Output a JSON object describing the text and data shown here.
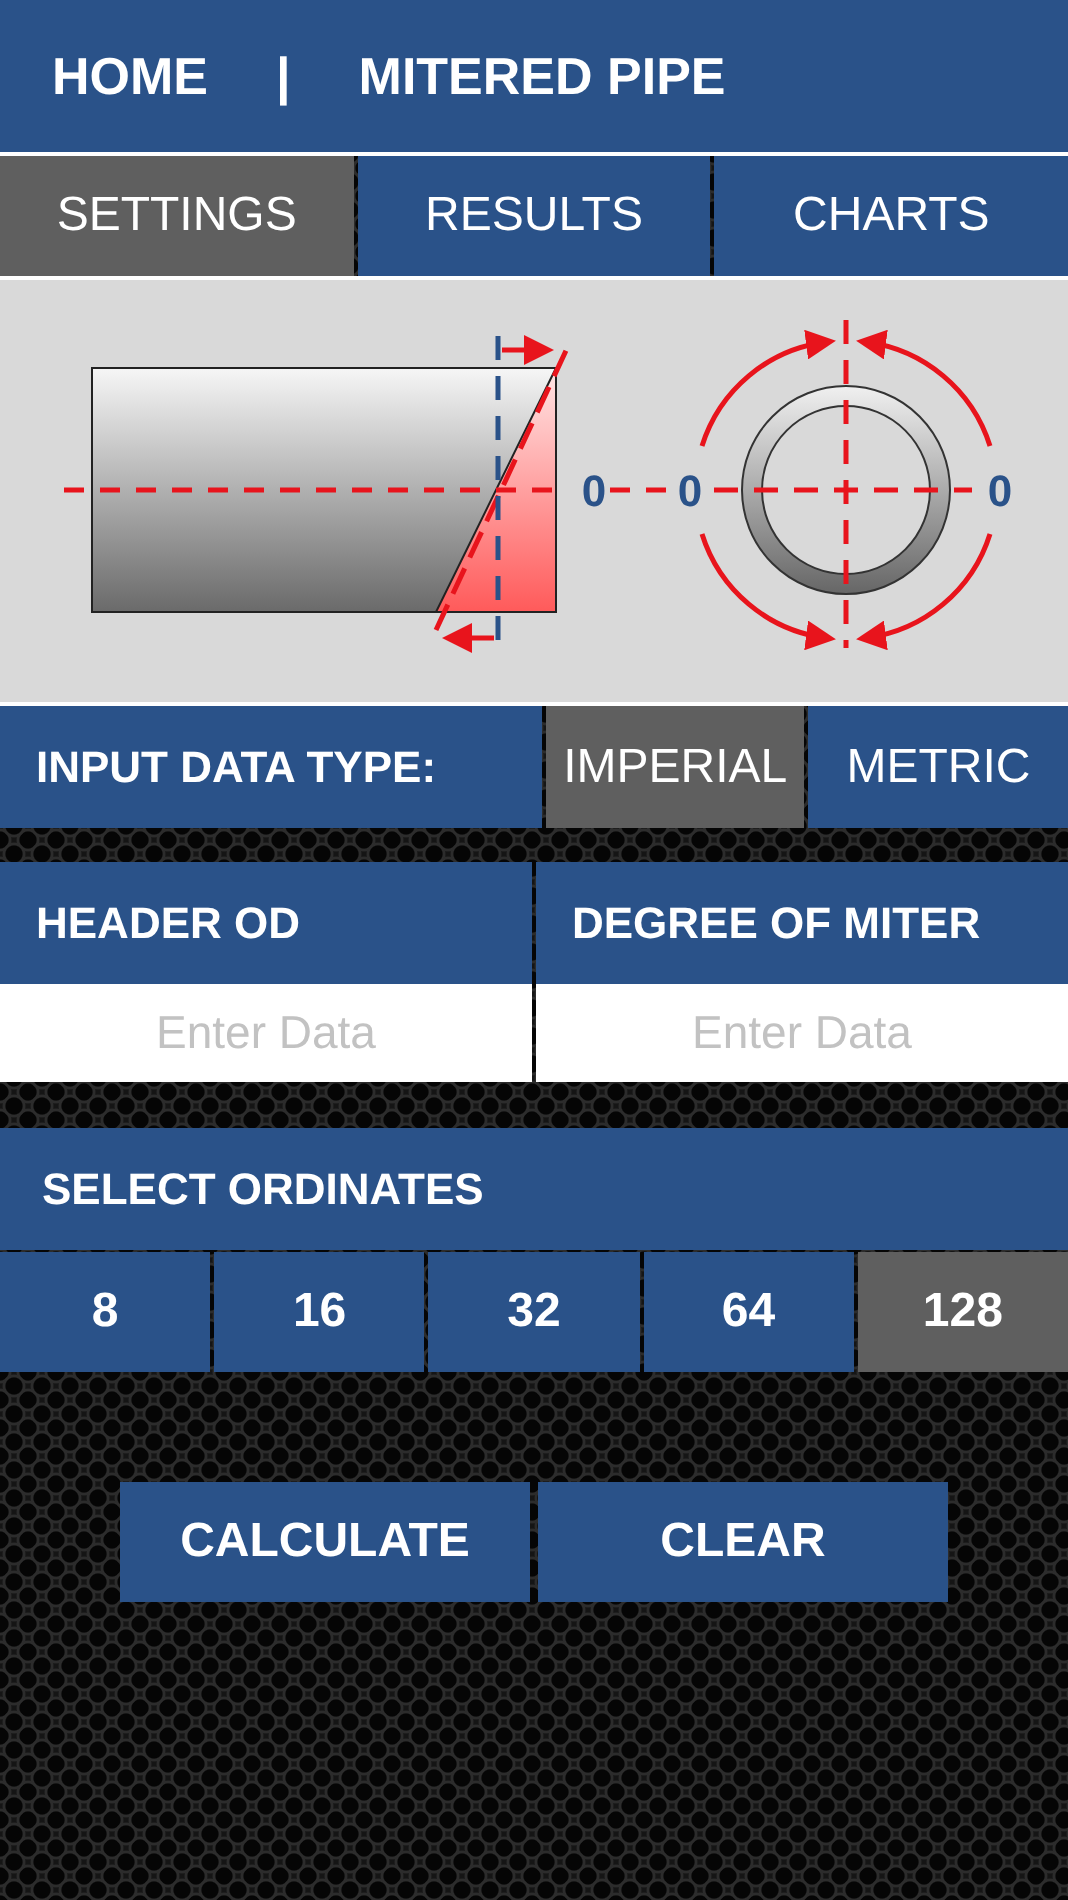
{
  "header": {
    "home": "HOME",
    "separator": "|",
    "title": "MITERED PIPE"
  },
  "tabs": [
    {
      "label": "SETTINGS",
      "selected": true
    },
    {
      "label": "RESULTS",
      "selected": false
    },
    {
      "label": "CHARTS",
      "selected": false
    }
  ],
  "diagram": {
    "labels": [
      "0",
      "0",
      "0"
    ]
  },
  "input_type": {
    "label": "INPUT DATA TYPE:",
    "options": [
      {
        "label": "IMPERIAL",
        "selected": true
      },
      {
        "label": "METRIC",
        "selected": false
      }
    ]
  },
  "fields": [
    {
      "label": "HEADER OD",
      "placeholder": "Enter Data"
    },
    {
      "label": "DEGREE OF MITER",
      "placeholder": "Enter Data"
    }
  ],
  "ordinates": {
    "label": "SELECT ORDINATES",
    "options": [
      {
        "label": "8",
        "selected": false
      },
      {
        "label": "16",
        "selected": false
      },
      {
        "label": "32",
        "selected": false
      },
      {
        "label": "64",
        "selected": false
      },
      {
        "label": "128",
        "selected": true
      }
    ]
  },
  "buttons": [
    "CALCULATE",
    "CLEAR"
  ]
}
